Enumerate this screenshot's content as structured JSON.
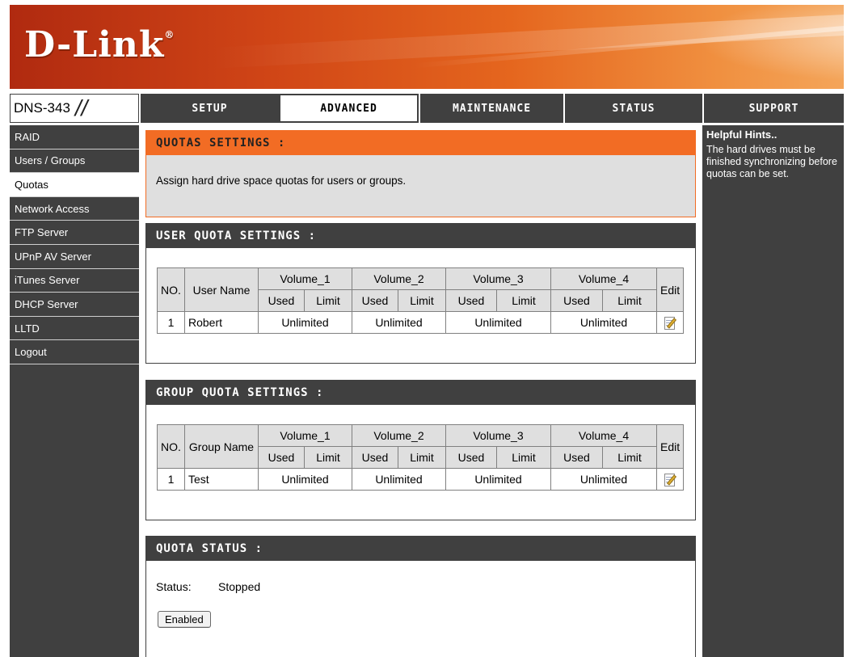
{
  "brand": {
    "logo": "D-Link",
    "model": "DNS-343"
  },
  "nav": {
    "tabs": [
      {
        "label": "SETUP"
      },
      {
        "label": "ADVANCED"
      },
      {
        "label": "MAINTENANCE"
      },
      {
        "label": "STATUS"
      },
      {
        "label": "SUPPORT"
      }
    ],
    "active_tab": "ADVANCED"
  },
  "sidebar": {
    "items": [
      {
        "label": "RAID"
      },
      {
        "label": "Users / Groups"
      },
      {
        "label": "Quotas"
      },
      {
        "label": "Network Access"
      },
      {
        "label": "FTP Server"
      },
      {
        "label": "UPnP AV Server"
      },
      {
        "label": "iTunes Server"
      },
      {
        "label": "DHCP Server"
      },
      {
        "label": "LLTD"
      },
      {
        "label": "Logout"
      }
    ],
    "active_item": "Quotas"
  },
  "hints": {
    "title": "Helpful Hints..",
    "text": "The hard drives must be finished synchronizing before quotas can be set."
  },
  "quotas_settings": {
    "title": "QUOTAS SETTINGS :",
    "description": "Assign hard drive space quotas for users or groups."
  },
  "volumes": [
    "Volume_1",
    "Volume_2",
    "Volume_3",
    "Volume_4"
  ],
  "sub_headers": {
    "used": "Used",
    "limit": "Limit",
    "no": "NO.",
    "edit": "Edit"
  },
  "user_quota": {
    "title": "USER QUOTA SETTINGS :",
    "name_header": "User Name",
    "rows": [
      {
        "no": "1",
        "name": "Robert",
        "values": [
          "Unlimited",
          "Unlimited",
          "Unlimited",
          "Unlimited"
        ]
      }
    ]
  },
  "group_quota": {
    "title": "GROUP QUOTA SETTINGS :",
    "name_header": "Group Name",
    "rows": [
      {
        "no": "1",
        "name": "Test",
        "values": [
          "Unlimited",
          "Unlimited",
          "Unlimited",
          "Unlimited"
        ]
      }
    ]
  },
  "quota_status": {
    "title": "QUOTA STATUS :",
    "status_label": "Status:",
    "status_value": "Stopped",
    "button_label": "Enabled"
  },
  "colors": {
    "accent_orange": "#f26c24",
    "dark_grey": "#404040",
    "light_grey": "#dfdfdf"
  }
}
